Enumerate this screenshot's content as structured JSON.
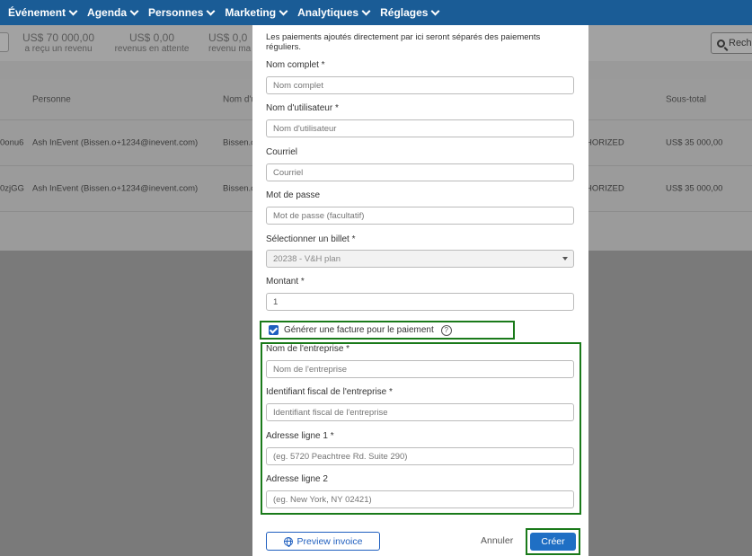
{
  "nav": {
    "items": [
      {
        "label": "Événement"
      },
      {
        "label": "Agenda"
      },
      {
        "label": "Personnes"
      },
      {
        "label": "Marketing"
      },
      {
        "label": "Analytiques"
      },
      {
        "label": "Réglages"
      }
    ]
  },
  "stats": [
    {
      "value": "US$ 70 000,00",
      "label": "a reçu un revenu"
    },
    {
      "value": "US$ 0,00",
      "label": "revenus en attente"
    },
    {
      "value": "US$ 0,0",
      "label": "revenu ma"
    }
  ],
  "search": {
    "label": "Rech"
  },
  "table": {
    "headers": {
      "person": "Personne",
      "name": "Nom d'u",
      "status": "t",
      "subtotal": "Sous-total"
    },
    "rows": [
      {
        "id": "0onu6",
        "person": "Ash InEvent (Bissen.o+1234@inevent.com)",
        "name": "Bissen.o",
        "status": "HORIZED",
        "subtotal": "US$ 35 000,00"
      },
      {
        "id": "0zjGG",
        "person": "Ash InEvent (Bissen.o+1234@inevent.com)",
        "name": "Bissen.o",
        "status": "HORIZED",
        "subtotal": "US$ 35 000,00"
      }
    ]
  },
  "modal": {
    "intro": "Les paiements ajoutés directement par ici seront séparés des paiements réguliers.",
    "fields": {
      "full_name": {
        "label": "Nom complet *",
        "placeholder": "Nom complet"
      },
      "username": {
        "label": "Nom d'utilisateur *",
        "placeholder": "Nom d'utilisateur"
      },
      "email": {
        "label": "Courriel",
        "placeholder": "Courriel"
      },
      "password": {
        "label": "Mot de passe",
        "placeholder": "Mot de passe (facultatif)"
      },
      "ticket": {
        "label": "Sélectionner un billet *",
        "value": "20238 - V&H plan"
      },
      "amount": {
        "label": "Montant *",
        "value": "1"
      },
      "company_name": {
        "label": "Nom de l'entreprise *",
        "placeholder": "Nom de l'entreprise"
      },
      "tax_id": {
        "label": "Identifiant fiscal de l'entreprise *",
        "placeholder": "Identifiant fiscal de l'entreprise"
      },
      "address1": {
        "label": "Adresse ligne 1 *",
        "placeholder": "(eg. 5720 Peachtree Rd. Suite 290)"
      },
      "address2": {
        "label": "Adresse ligne 2",
        "placeholder": "(eg. New York, NY 02421)"
      }
    },
    "invoice_checkbox": {
      "label": "Générer une facture pour le paiement",
      "checked": true,
      "help": "?"
    },
    "buttons": {
      "preview": "Preview invoice",
      "cancel": "Annuler",
      "create": "Créer"
    }
  },
  "colors": {
    "nav_bg": "#1a5c96",
    "primary": "#1f6fc4",
    "highlight": "#1a7a1a"
  }
}
